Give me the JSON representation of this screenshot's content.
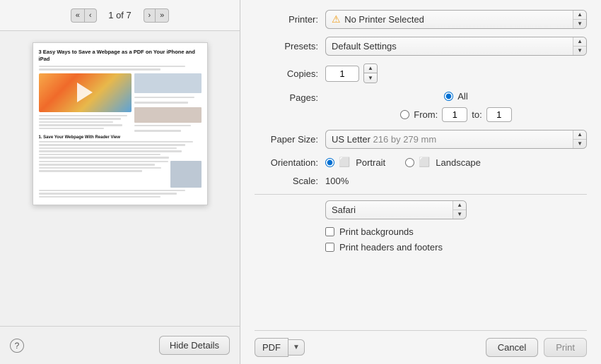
{
  "left": {
    "pageIndicator": "1 of 7",
    "navButtons": {
      "firstPage": "«",
      "prevPage": "‹",
      "nextPage": "›",
      "lastPage": "»"
    },
    "helpButton": "?",
    "hideDetailsButton": "Hide Details"
  },
  "right": {
    "printer": {
      "label": "Printer:",
      "warningIcon": "⚠",
      "value": "No Printer Selected",
      "spinnerUp": "▲",
      "spinnerDown": "▼"
    },
    "presets": {
      "label": "Presets:",
      "value": "Default Settings",
      "spinnerUp": "▲",
      "spinnerDown": "▼"
    },
    "copies": {
      "label": "Copies:",
      "value": "1",
      "stepUp": "▲",
      "stepDown": "▼"
    },
    "pages": {
      "label": "Pages:",
      "allLabel": "All",
      "fromLabel": "From:",
      "fromValue": "1",
      "toLabel": "to:",
      "toValue": "1"
    },
    "paperSize": {
      "label": "Paper Size:",
      "value": "US Letter",
      "valueExtra": "216 by 279 mm",
      "spinnerUp": "▲",
      "spinnerDown": "▼"
    },
    "orientation": {
      "label": "Orientation:",
      "portraitLabel": "Portrait",
      "landscapeLabel": "Landscape"
    },
    "scale": {
      "label": "Scale:",
      "value": "100%"
    },
    "safari": {
      "dropdownValue": "Safari",
      "spinnerUp": "▲",
      "spinnerDown": "▼",
      "checkboxes": [
        {
          "id": "cb-backgrounds",
          "label": "Print backgrounds",
          "checked": false
        },
        {
          "id": "cb-headers",
          "label": "Print headers and footers",
          "checked": false
        }
      ]
    },
    "bottomBar": {
      "pdfLabel": "PDF",
      "pdfDropdown": "▼",
      "cancelLabel": "Cancel",
      "printLabel": "Print"
    }
  }
}
